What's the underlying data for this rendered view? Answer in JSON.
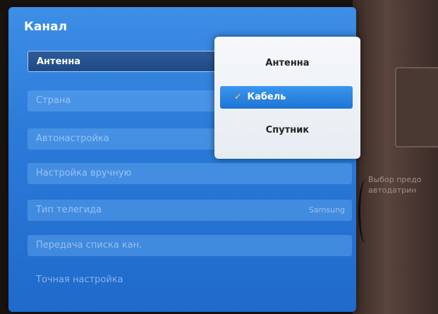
{
  "panel": {
    "title": "Канал",
    "items": [
      {
        "label": "Антенна",
        "selected": true
      },
      {
        "label": "Страна"
      },
      {
        "label": "Автонастройка"
      },
      {
        "label": "Настройка вручную"
      },
      {
        "label": "Тип телегида",
        "value": "Samsung"
      },
      {
        "label": "Передача списка кан."
      },
      {
        "label": "Точная настройка"
      }
    ]
  },
  "popup": {
    "options": [
      {
        "label": "Антенна"
      },
      {
        "label": "Кабель",
        "active": true
      },
      {
        "label": "Спутник"
      }
    ],
    "check_icon": "✓",
    "return_icon": "↺"
  },
  "side_hint": "Выбор предо автодатрин",
  "colors": {
    "accent": "#2a79d8",
    "highlight": "#1f74d3",
    "check": "#ffd43a"
  }
}
